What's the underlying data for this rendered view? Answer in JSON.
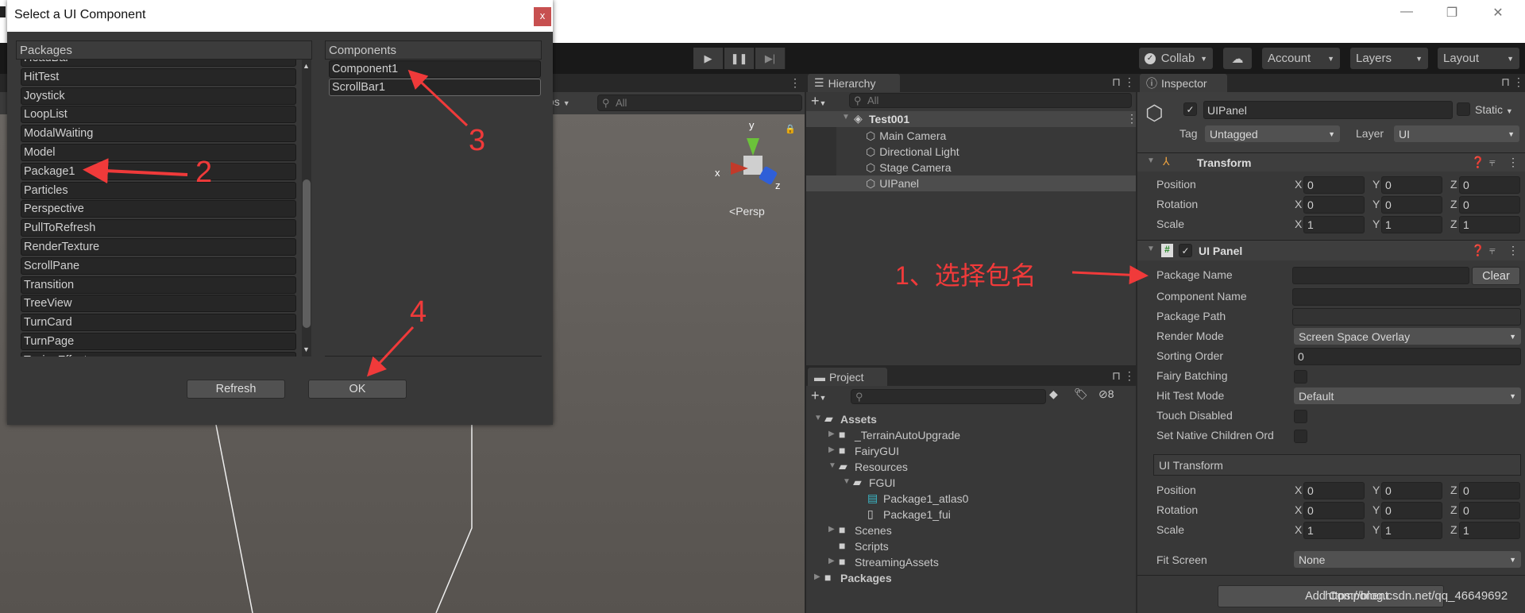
{
  "window_controls": {
    "minimize": "—",
    "restore": "❐",
    "close": "✕"
  },
  "toolbar": {
    "collab": "Collab",
    "account": "Account",
    "layers": "Layers",
    "layout": "Layout",
    "dropdown_arrow": "▼"
  },
  "scene": {
    "search_placeholder": "All",
    "gizmo_mode": "os",
    "persp": "Persp",
    "axis_x": "x",
    "axis_y": "y",
    "axis_z": "z"
  },
  "dialog": {
    "title": "Select a UI Component",
    "close": "x",
    "packages_header": "Packages",
    "components_header": "Components",
    "packages": [
      "HeadBar",
      "HitTest",
      "Joystick",
      "LoopList",
      "ModalWaiting",
      "Model",
      "Package1",
      "Particles",
      "Perspective",
      "PullToRefresh",
      "RenderTexture",
      "ScrollPane",
      "Transition",
      "TreeView",
      "TurnCard",
      "TurnPage",
      "TypingEffect"
    ],
    "components": [
      "Component1",
      "ScrollBar1"
    ],
    "refresh": "Refresh",
    "ok": "OK"
  },
  "hierarchy": {
    "tab": "Hierarchy",
    "search_placeholder": "All",
    "scene": "Test001",
    "items": [
      "Main Camera",
      "Directional Light",
      "Stage Camera",
      "UIPanel"
    ],
    "selected": "UIPanel"
  },
  "project": {
    "tab": "Project",
    "hidden_count": "8",
    "tree": [
      {
        "label": "Assets",
        "level": 0,
        "arrow": "open",
        "icon": "folder-open",
        "bold": true
      },
      {
        "label": "_TerrainAutoUpgrade",
        "level": 1,
        "arrow": "closed",
        "icon": "folder"
      },
      {
        "label": "FairyGUI",
        "level": 1,
        "arrow": "closed",
        "icon": "folder"
      },
      {
        "label": "Resources",
        "level": 1,
        "arrow": "open",
        "icon": "folder-open"
      },
      {
        "label": "FGUI",
        "level": 2,
        "arrow": "open",
        "icon": "folder-open"
      },
      {
        "label": "Package1_atlas0",
        "level": 3,
        "arrow": "none",
        "icon": "texture"
      },
      {
        "label": "Package1_fui",
        "level": 3,
        "arrow": "none",
        "icon": "file"
      },
      {
        "label": "Scenes",
        "level": 1,
        "arrow": "closed",
        "icon": "folder"
      },
      {
        "label": "Scripts",
        "level": 1,
        "arrow": "none",
        "icon": "folder"
      },
      {
        "label": "StreamingAssets",
        "level": 1,
        "arrow": "closed",
        "icon": "folder"
      },
      {
        "label": "Packages",
        "level": 0,
        "arrow": "closed",
        "icon": "folder",
        "bold": true
      }
    ]
  },
  "inspector": {
    "tab": "Inspector",
    "object_name": "UIPanel",
    "static": "Static",
    "tag_label": "Tag",
    "tag": "Untagged",
    "layer_label": "Layer",
    "layer": "UI",
    "transform": {
      "title": "Transform",
      "rows": [
        {
          "label": "Position",
          "x": "0",
          "y": "0",
          "z": "0"
        },
        {
          "label": "Rotation",
          "x": "0",
          "y": "0",
          "z": "0"
        },
        {
          "label": "Scale",
          "x": "1",
          "y": "1",
          "z": "1"
        }
      ]
    },
    "ui_panel": {
      "title": "UI Panel",
      "package_name": "Package Name",
      "package_name_value": "",
      "clear": "Clear",
      "component_name": "Component Name",
      "component_name_value": "",
      "package_path": "Package Path",
      "package_path_value": "",
      "render_mode": "Render Mode",
      "render_mode_value": "Screen Space Overlay",
      "sorting_order": "Sorting Order",
      "sorting_order_value": "0",
      "fairy_batching": "Fairy Batching",
      "hit_test_mode": "Hit Test Mode",
      "hit_test_mode_value": "Default",
      "touch_disabled": "Touch Disabled",
      "set_native": "Set Native Children Ord",
      "ui_transform": "UI Transform",
      "rows": [
        {
          "label": "Position",
          "x": "0",
          "y": "0",
          "z": "0"
        },
        {
          "label": "Rotation",
          "x": "0",
          "y": "0",
          "z": "0"
        },
        {
          "label": "Scale",
          "x": "1",
          "y": "1",
          "z": "1"
        }
      ],
      "fit_screen": "Fit Screen",
      "fit_screen_value": "None"
    },
    "add_component": "Add Component",
    "axis_labels": [
      "X",
      "Y",
      "Z"
    ]
  },
  "annotations": {
    "step1": "1、选择包名",
    "step2": "2",
    "step3": "3",
    "step4": "4",
    "color": "#f03a3a"
  },
  "watermark": "https://blog.csdn.net/qq_46649692"
}
